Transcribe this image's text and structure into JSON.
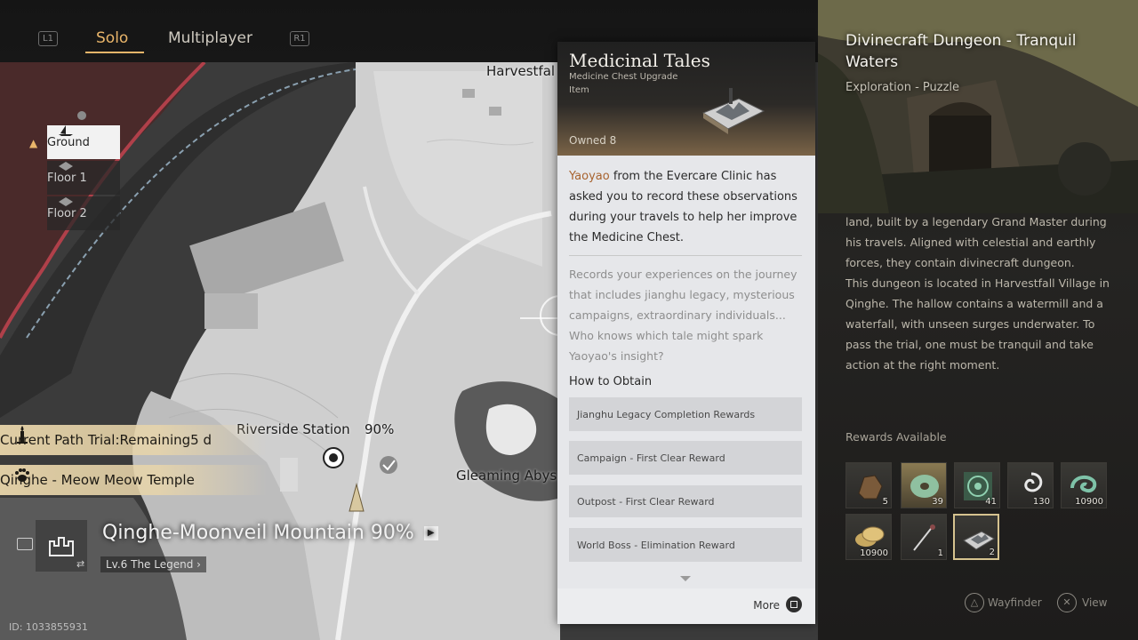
{
  "tabs": {
    "left_hint": "L1",
    "right_hint": "R1",
    "items": [
      {
        "label": "Solo",
        "active": true
      },
      {
        "label": "Multiplayer",
        "active": false
      }
    ]
  },
  "floors": [
    {
      "label": "Ground",
      "active": true
    },
    {
      "label": "Floor 1",
      "active": false
    },
    {
      "label": "Floor 2",
      "active": false
    }
  ],
  "map": {
    "labels": {
      "harvestfall": "Harvestfal",
      "riverside": "Riverside Station",
      "riverside_pct": "90%",
      "gleaming": "Gleaming Abys"
    },
    "trials": [
      {
        "text": "Current Path Trial:Remaining5 d",
        "icon": "candle-icon"
      },
      {
        "text": "Qinghe - Meow Meow Temple",
        "icon": "paw-icon"
      }
    ],
    "region": "Qinghe-Moonveil Mountain 90%",
    "level": "Lv.6 The Legend",
    "player_id": "ID: 1033855931"
  },
  "item": {
    "name": "Medicinal Tales",
    "subtype": "Medicine Chest Upgrade",
    "category": "Item",
    "owned": "Owned 8",
    "desc_highlight": "Yaoyao",
    "desc_rest": " from the Evercare Clinic has asked you to record these observations during your travels to help her improve the Medicine Chest.",
    "flavor": "Records your experiences on the journey that includes jianghu legacy, mysterious campaigns, extraordinary individuals... Who knows which tale might spark Yaoyao's insight?",
    "how_to_obtain_title": "How to Obtain",
    "obtain": [
      "Jianghu Legacy Completion Rewards",
      "Campaign - First Clear Reward",
      "Outpost - First Clear Reward",
      "World Boss - Elimination Reward"
    ],
    "more_label": "More"
  },
  "dungeon": {
    "title": "Divinecraft Dungeon - Tranquil Waters",
    "type": "Exploration - Puzzle",
    "desc_p1": "land, built by a legendary Grand Master during his travels. Aligned with celestial and earthly forces, they contain divinecraft dungeon.",
    "desc_p2": "This dungeon is located in Harvestfall Village in Qinghe. The hallow contains a watermill and a waterfall, with unseen surges underwater. To pass the trial, one must be tranquil and take action at the right moment.",
    "rewards_title": "Rewards Available",
    "rewards": [
      {
        "qty": "5",
        "icon": "ore-icon"
      },
      {
        "qty": "39",
        "icon": "jade-disc-icon"
      },
      {
        "qty": "41",
        "icon": "target-token-icon"
      },
      {
        "qty": "130",
        "icon": "swirl-icon"
      },
      {
        "qty": "10900",
        "icon": "wave-jade-icon"
      },
      {
        "qty": "10900",
        "icon": "coins-icon"
      },
      {
        "qty": "1",
        "icon": "brush-icon"
      },
      {
        "qty": "2",
        "icon": "map-scroll-icon"
      }
    ],
    "wayfinder_label": "Wayfinder",
    "view_label": "View"
  }
}
